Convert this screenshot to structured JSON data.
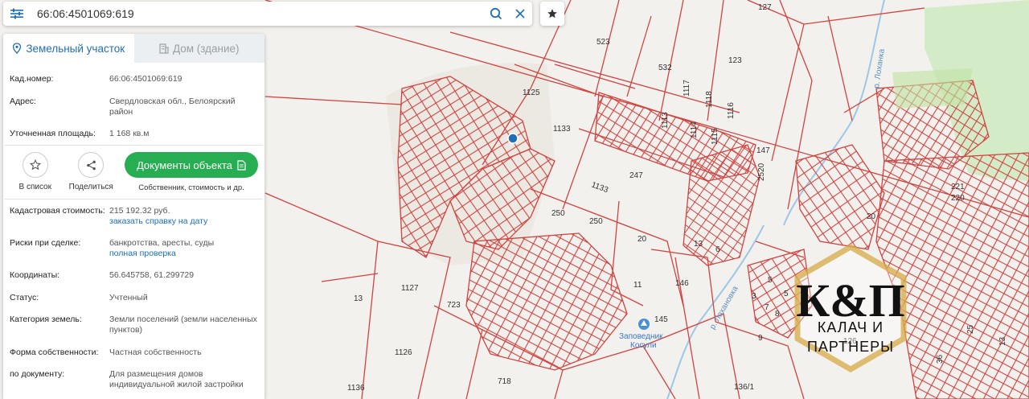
{
  "search": {
    "value": "66:06:4501069:619",
    "menu_icon": "sliders-icon",
    "search_icon": "search-icon",
    "clear_icon": "close-icon"
  },
  "favorite": {
    "icon": "star-icon"
  },
  "tabs": [
    {
      "label": "Земельный участок",
      "icon": "map-pin-icon",
      "active": true
    },
    {
      "label": "Дом (здание)",
      "icon": "building-icon",
      "active": false
    }
  ],
  "info_top": [
    {
      "label": "Кад.номер:",
      "value": "66:06:4501069:619",
      "is_link": true
    },
    {
      "label": "Адрес:",
      "value": "Свердловская обл., Белоярский район"
    },
    {
      "label": "Уточненная площадь:",
      "value": "1 168 кв.м"
    }
  ],
  "actions": {
    "add_to_list": "В список",
    "share": "Поделиться",
    "documents_button": "Документы объекта",
    "documents_sub": "Собственник, стоимость и др."
  },
  "info_bottom": [
    {
      "label": "Кадастровая стоимость:",
      "value": "215 192.32 руб.",
      "link": "заказать справку на дату"
    },
    {
      "label": "Риски при сделке:",
      "value": "банкротства, аресты, суды",
      "link": "полная проверка"
    },
    {
      "label": "Координаты:",
      "value": "56.645758, 61.299729"
    },
    {
      "label": "Статус:",
      "value": "Учтенный"
    },
    {
      "label": "Категория земель:",
      "value": "Земли поселений (земли населенных пунктов)"
    },
    {
      "label": "Форма собственности:",
      "value": "Частная собственность"
    },
    {
      "label": "по документу:",
      "value": "Для размещения домов индивидуальной жилой застройки"
    }
  ],
  "map": {
    "parcel_labels": [
      "127",
      "523",
      "532",
      "123",
      "1117",
      "1118",
      "1116",
      "1113",
      "1114",
      "1115",
      "1125",
      "1133",
      "147",
      "247",
      "2520",
      "1133",
      "250",
      "250",
      "20",
      "221",
      "220",
      "20",
      "13",
      "6",
      "11",
      "146",
      "145",
      "1127",
      "723",
      "1126",
      "718",
      "1136",
      "136/1",
      "13",
      "9",
      "126",
      "7",
      "8",
      "5",
      "3",
      "5",
      "36",
      "25",
      "13"
    ],
    "river_labels": [
      "р. Лоханка",
      "р. Лохановка"
    ],
    "poi": {
      "name": "Заповедник Косули",
      "icon": "reserve-pin-icon"
    },
    "colors": {
      "parcel_line": "#d0433f",
      "green_area": "#d3ebc7",
      "selected_marker": "#1f6fb5"
    }
  },
  "watermark": {
    "line1": "К&П",
    "line2": "КАЛАЧ И",
    "line3": "ПАРТНЕРЫ"
  }
}
